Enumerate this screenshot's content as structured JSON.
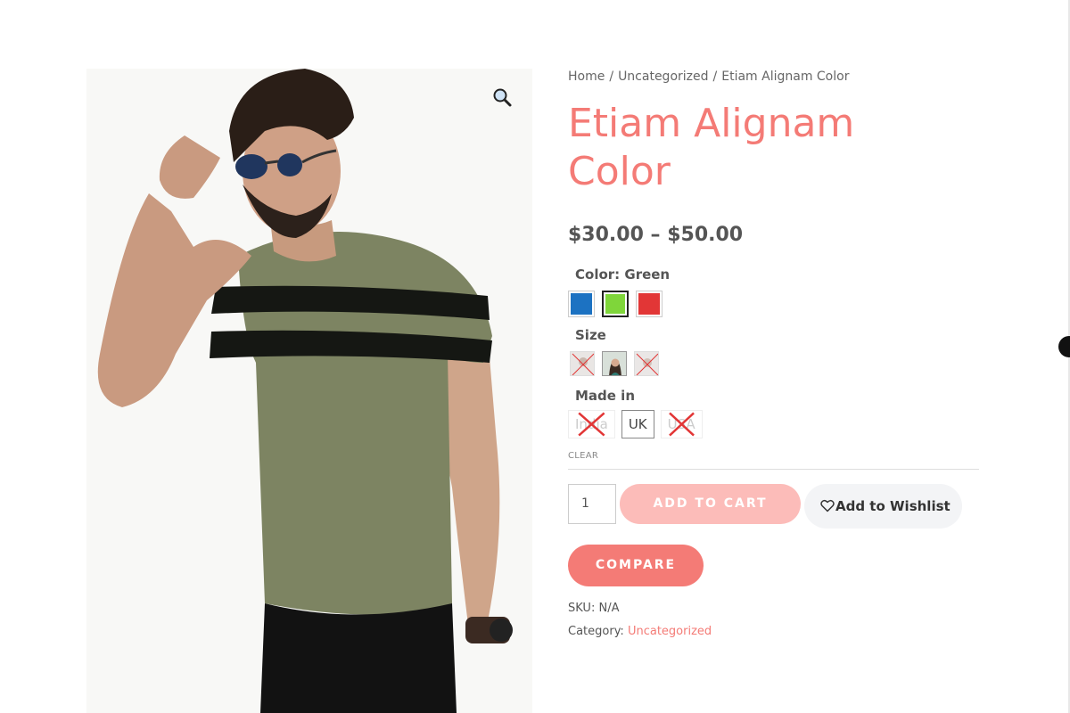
{
  "breadcrumb": {
    "home": "Home",
    "category": "Uncategorized",
    "current": "Etiam Alignam Color",
    "separator": "/"
  },
  "product": {
    "title": "Etiam Alignam Color",
    "price": "$30.00 – $50.00"
  },
  "gallery": {
    "zoom_icon": "magnifier-icon"
  },
  "variations": {
    "color_label": "Color: Green",
    "colors": [
      {
        "name": "Blue",
        "hex": "#1c72c2",
        "selected": false
      },
      {
        "name": "Green",
        "hex": "#7fd63a",
        "selected": true
      },
      {
        "name": "Red",
        "hex": "#e23636",
        "selected": false
      }
    ],
    "size_label": "Size",
    "made_in_label": "Made in",
    "made_in": [
      {
        "label": "India",
        "available": false
      },
      {
        "label": "UK",
        "available": true
      },
      {
        "label": "USA",
        "available": false
      }
    ],
    "clear": "CLEAR"
  },
  "cart": {
    "quantity": "1",
    "add_to_cart": "ADD TO CART",
    "wishlist": "Add to Wishlist",
    "compare": "COMPARE"
  },
  "meta": {
    "sku_label": "SKU:",
    "sku_value": "N/A",
    "category_label": "Category:",
    "category_value": "Uncategorized"
  },
  "colors": {
    "accent": "#f47b76",
    "add_to_cart_disabled": "#fcbcb9",
    "text": "#555555"
  }
}
